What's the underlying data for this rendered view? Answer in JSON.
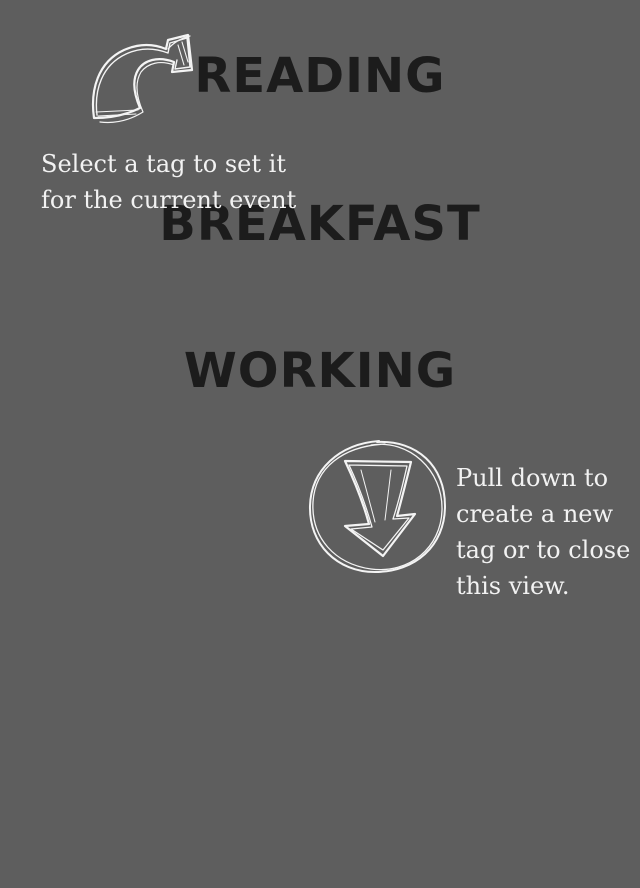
{
  "tags": [
    {
      "label": "READING"
    },
    {
      "label": "BREAKFAST"
    },
    {
      "label": "WORKING"
    }
  ],
  "hints": {
    "select_tag": {
      "lines": [
        "Select a tag to set it",
        "for the current event"
      ],
      "icon": "curved-arrow-icon"
    },
    "pull_down": {
      "lines": [
        "Pull down to",
        "create a new",
        "tag or to close",
        "this view."
      ],
      "icon": "circled-down-arrow-icon"
    }
  },
  "colors": {
    "background": "#5e5e5e",
    "tag_text": "#1c1c1c",
    "hint_text": "#f2f2f2"
  }
}
